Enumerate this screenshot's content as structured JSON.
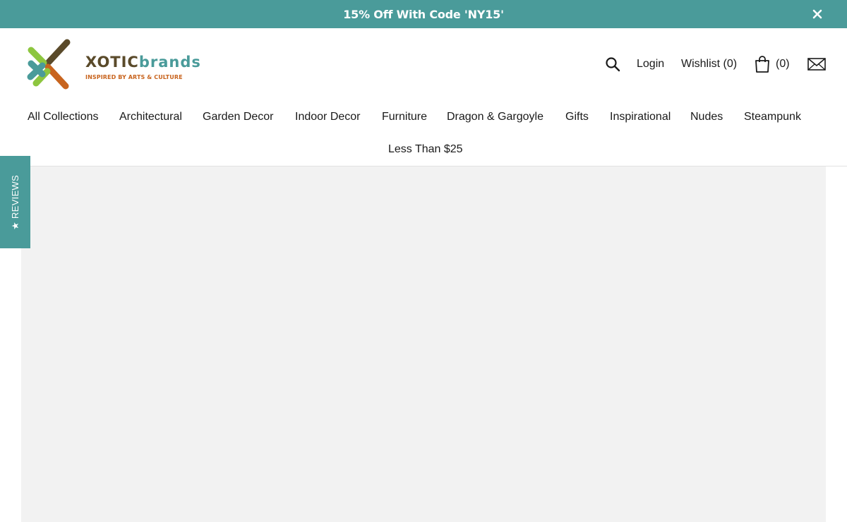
{
  "announcement": {
    "text": "15% Off With Code 'NY15'",
    "close_icon": "close-icon"
  },
  "brand": {
    "name_part1": "XOTIC",
    "name_part2": "brands",
    "tagline": "INSPIRED BY ARTS & CULTURE",
    "logo_icon": "x-logo-icon",
    "colors": {
      "teal": "#4a9b9a",
      "brown": "#5a4a2a",
      "green": "#8dc63f",
      "orange": "#c8641e"
    }
  },
  "utility": {
    "search_icon": "search-icon",
    "login_label": "Login",
    "wishlist_label": "Wishlist (0)",
    "cart_icon": "shopping-bag-icon",
    "cart_count": "(0)",
    "mail_icon": "envelope-icon"
  },
  "nav": {
    "items": [
      {
        "label": "All Collections"
      },
      {
        "label": "Architectural"
      },
      {
        "label": "Garden Decor"
      },
      {
        "label": "Indoor Decor"
      },
      {
        "label": "Furniture"
      },
      {
        "label": "Dragon & Gargoyle"
      },
      {
        "label": "Gifts"
      },
      {
        "label": "Inspirational"
      },
      {
        "label": "Nudes"
      },
      {
        "label": "Steampunk"
      },
      {
        "label": "Less Than $25"
      }
    ]
  },
  "reviews_tab": {
    "star": "★",
    "label": "REVIEWS"
  },
  "theme": {
    "accent": "#4a9b9a",
    "hero_background": "#f2f2f2"
  }
}
